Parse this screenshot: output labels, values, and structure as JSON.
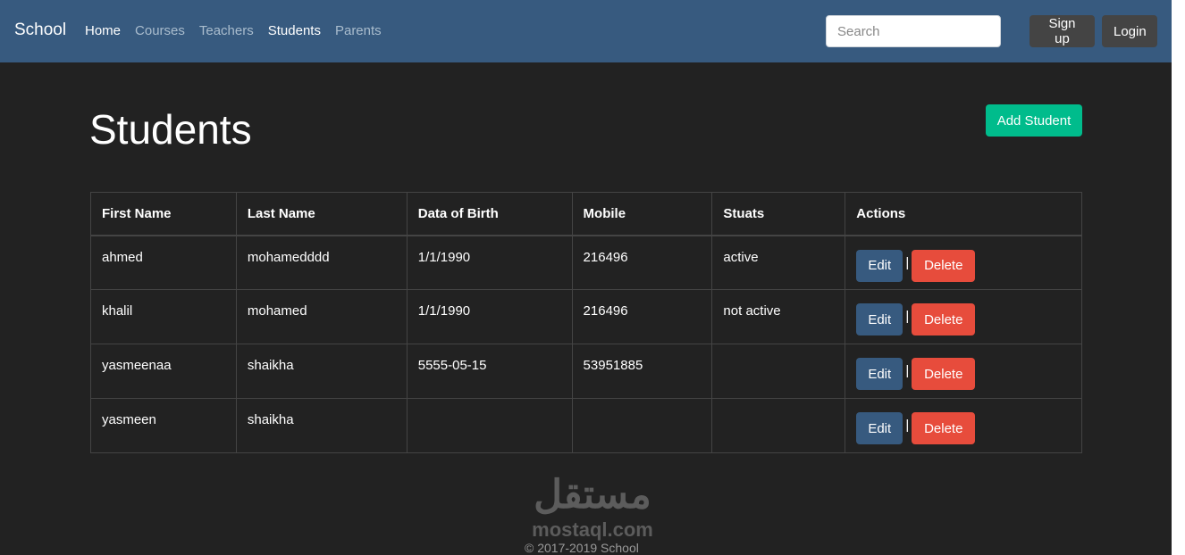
{
  "navbar": {
    "brand": "School",
    "links": [
      {
        "label": "Home"
      },
      {
        "label": "Courses"
      },
      {
        "label": "Teachers"
      },
      {
        "label": "Students"
      },
      {
        "label": "Parents"
      }
    ],
    "search_placeholder": "Search",
    "signup_label": "Sign up",
    "login_label": "Login"
  },
  "main": {
    "title": "Students",
    "add_button_label": "Add Student"
  },
  "table": {
    "headers": [
      "First Name",
      "Last Name",
      "Data of Birth",
      "Mobile",
      "Stuats",
      "Actions"
    ],
    "rows": [
      {
        "first": "ahmed",
        "last": "mohamedddd",
        "dob": "1/1/1990",
        "mobile": "216496",
        "status": "active"
      },
      {
        "first": "khalil",
        "last": "mohamed",
        "dob": "1/1/1990",
        "mobile": "216496",
        "status": "not active"
      },
      {
        "first": "yasmeenaa",
        "last": "shaikha",
        "dob": "5555-05-15",
        "mobile": "53951885",
        "status": ""
      },
      {
        "first": "yasmeen",
        "last": "shaikha",
        "dob": "",
        "mobile": "",
        "status": ""
      }
    ],
    "edit_label": "Edit",
    "separator": "|",
    "delete_label": "Delete"
  },
  "watermark": {
    "arabic": "مستقل",
    "latin": "mostaql.com"
  },
  "footer": {
    "copyright": "© 2017-2019 School"
  },
  "colors": {
    "navbar": "#375a7f",
    "background": "#222222",
    "add_button": "#00bc8c",
    "edit_button": "#375a7f",
    "delete_button": "#e74c3c"
  }
}
